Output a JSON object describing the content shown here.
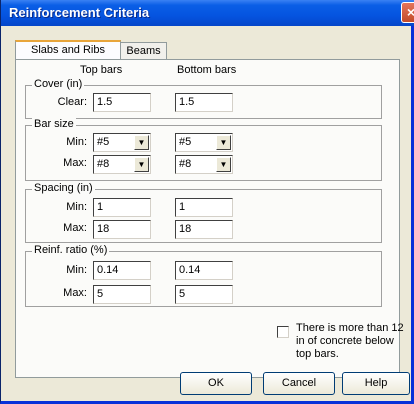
{
  "window": {
    "title": "Reinforcement Criteria",
    "close_glyph": "×"
  },
  "tabs": [
    {
      "label": "Slabs and Ribs"
    },
    {
      "label": "Beams"
    }
  ],
  "columns": {
    "top": "Top bars",
    "bottom": "Bottom bars"
  },
  "groups": {
    "cover": {
      "label": "Cover (in)",
      "rows": [
        {
          "label": "Clear:",
          "top": "1.5",
          "bottom": "1.5"
        }
      ]
    },
    "bar_size": {
      "label": "Bar size",
      "rows": [
        {
          "label": "Min:",
          "top": "#5",
          "bottom": "#5"
        },
        {
          "label": "Max:",
          "top": "#8",
          "bottom": "#8"
        }
      ]
    },
    "spacing": {
      "label": "Spacing (in)",
      "rows": [
        {
          "label": "Min:",
          "top": "1",
          "bottom": "1"
        },
        {
          "label": "Max:",
          "top": "18",
          "bottom": "18"
        }
      ]
    },
    "ratio": {
      "label": "Reinf. ratio (%)",
      "rows": [
        {
          "label": "Min:",
          "top": "0.14",
          "bottom": "0.14"
        },
        {
          "label": "Max:",
          "top": "5",
          "bottom": "5"
        }
      ]
    }
  },
  "checkbox": {
    "label": "There is more than 12 in of concrete below top bars.",
    "checked": false
  },
  "buttons": {
    "ok": "OK",
    "cancel": "Cancel",
    "help": "Help"
  },
  "icons": {
    "dropdown": "chevron-down-icon",
    "close": "close-icon"
  },
  "colors": {
    "titlebar": "#0554e0",
    "dialog_bg": "#ece9d8",
    "panel_bg": "#fbfbf9",
    "close": "#c24b2a"
  }
}
